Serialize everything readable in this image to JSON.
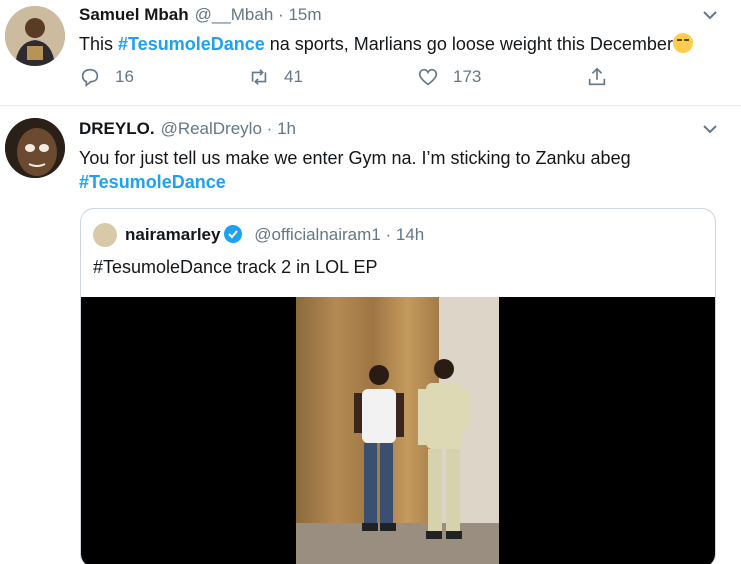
{
  "tweets": [
    {
      "name": "Samuel Mbah",
      "handle": "@__Mbah",
      "separator": "·",
      "time": "15m",
      "text_pre": "This ",
      "hashtag": "#TesumoleDance",
      "text_post": " na sports, Marlians go loose weight this December",
      "emoji": "face-with-tears-of-joy",
      "replies": "16",
      "retweets": "41",
      "likes": "173"
    },
    {
      "name": "DREYLO.",
      "handle": "@RealDreylo",
      "separator": "·",
      "time": "1h",
      "text_line1": "You for just tell us make we enter Gym na. I’m sticking to Zanku abeg",
      "hashtag": "#TesumoleDance",
      "quote": {
        "name": "nairamarley",
        "handle": "@officialnairam1",
        "separator": "·",
        "time": "14h",
        "text": "#TesumoleDance track 2 in LOL EP"
      }
    }
  ],
  "colors": {
    "accent": "#1da1f2",
    "secondary_text": "#657786",
    "border": "#e6ecf0"
  }
}
